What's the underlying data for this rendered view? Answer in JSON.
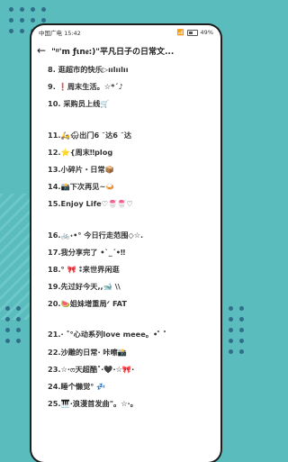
{
  "status": {
    "carrier": "中国广电 15:42",
    "battery": "49%"
  },
  "header": {
    "title": "\"ᵎᵎ'm ƒιnᧉ:)\"平凡日子の日常文..."
  },
  "list": {
    "items": [
      "8. 逛超市的快乐▷ıılıılıı",
      "9. ❗周末生活。☆*´♪",
      "10. 采购员上线🛒",
      "11.🛵🌨出门6 ˘达6 ˘达",
      "12.⭐{周末‼plog",
      "13.小碎片・日常📦",
      "14.📸下次再见~🍛",
      "15.Enjoy Life♡🍧🍧♡",
      "16.🚲˖•° 今日行走范围◇☆.",
      "17.我分享完了 •`_´•‼",
      "18.° 🎀 ⁑来世界闲逛",
      "19.先过好今天,,🐋 \\\\",
      "20.🍉姐妹增重局ᐟ FAT",
      "21.· ˚°心动系列love meee。• ̊ ˚",
      "22.沙雕的日常· 咔嚓📸",
      "23.☆·ෆ天超酷˚·🖤·☆🎀·",
      "24.睡个懒觉° 💤",
      "25.🎹·浪漫首发曲\"。☆·。"
    ]
  }
}
